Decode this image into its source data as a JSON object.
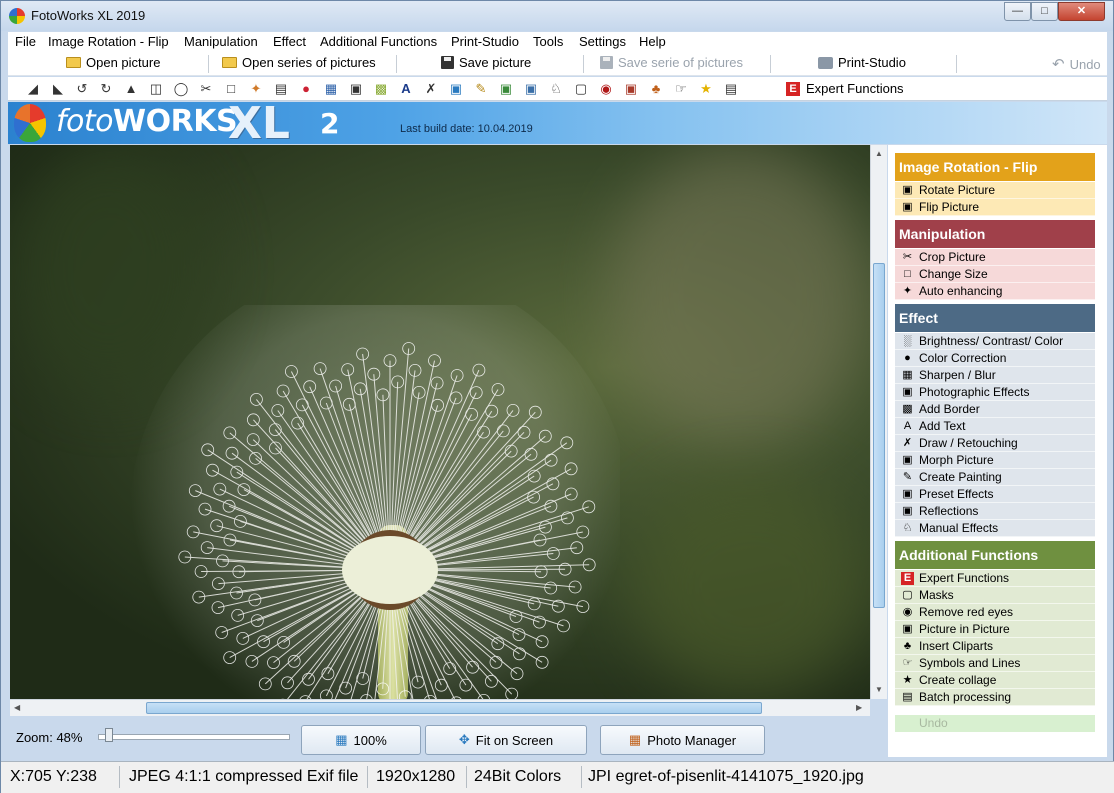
{
  "window": {
    "title": "FotoWorks XL 2019"
  },
  "menu": [
    "File",
    "Image Rotation - Flip",
    "Manipulation",
    "Effect",
    "Additional Functions",
    "Print-Studio",
    "Tools",
    "Settings",
    "Help"
  ],
  "toolbar1": {
    "open_picture": "Open picture",
    "open_series": "Open series of pictures",
    "save_picture": "Save picture",
    "save_series": "Save serie of pictures",
    "print_studio": "Print-Studio",
    "undo": "Undo"
  },
  "toolbar2": {
    "icons": [
      "rotate-left-icon",
      "rotate-right-icon",
      "rotate-ccw-icon",
      "rotate-cw-icon",
      "straighten-icon",
      "flip-icon",
      "mirror-icon",
      "crop-icon",
      "resize-icon",
      "auto-enhance-icon",
      "levels-icon",
      "color-icon",
      "sharpen-icon",
      "photo-effects-icon",
      "border-icon",
      "text-icon",
      "draw-icon",
      "morph-icon",
      "paint-icon",
      "preset-icon",
      "reflection-icon",
      "manual-icon",
      "frame-icon",
      "red-eye-icon",
      "picture-in-picture-icon",
      "clipart-icon",
      "symbols-icon",
      "collage-icon",
      "batch-icon"
    ],
    "expert_functions": "Expert Functions"
  },
  "banner": {
    "logo_part1": "foto",
    "logo_part2": "WORKS",
    "logo_xl": "XL",
    "logo_version": "2",
    "build_date": "Last build date: 10.04.2019"
  },
  "zoom": {
    "label": "Zoom: 48%",
    "value_percent": 48
  },
  "buttons": {
    "hundred": "100%",
    "fit_on_screen": "Fit on Screen",
    "photo_manager": "Photo Manager"
  },
  "panel": {
    "rotation": {
      "title": "Image Rotation - Flip",
      "color": "#e3a21a",
      "item_color": "#fde9b5",
      "items": [
        "Rotate Picture",
        "Flip Picture"
      ]
    },
    "manipulation": {
      "title": "Manipulation",
      "color": "#a0404a",
      "item_color": "#f6d9d9",
      "items": [
        "Crop Picture",
        "Change Size",
        "Auto enhancing"
      ]
    },
    "effect": {
      "title": "Effect",
      "color": "#4d6a85",
      "item_color": "#dfe5ec",
      "items": [
        "Brightness/ Contrast/ Color",
        "Color Correction",
        "Sharpen / Blur",
        "Photographic Effects",
        "Add Border",
        "Add Text",
        "Draw / Retouching",
        "Morph Picture",
        "Create Painting",
        "Preset Effects",
        "Reflections",
        "Manual Effects"
      ]
    },
    "additional": {
      "title": "Additional Functions",
      "color": "#6f9040",
      "item_color": "#e1ead3",
      "items": [
        "Expert Functions",
        "Masks",
        "Remove red eyes",
        "Picture in Picture",
        "Insert Cliparts",
        "Symbols and Lines",
        "Create collage",
        "Batch processing"
      ]
    },
    "undo": "Undo"
  },
  "status": {
    "coords": "X:705 Y:238",
    "format": "JPEG 4:1:1 compressed Exif file",
    "dimensions": "1920x1280",
    "colors": "24Bit Colors",
    "filename": "JPI egret-of-pisenlit-4141075_1920.jpg"
  }
}
